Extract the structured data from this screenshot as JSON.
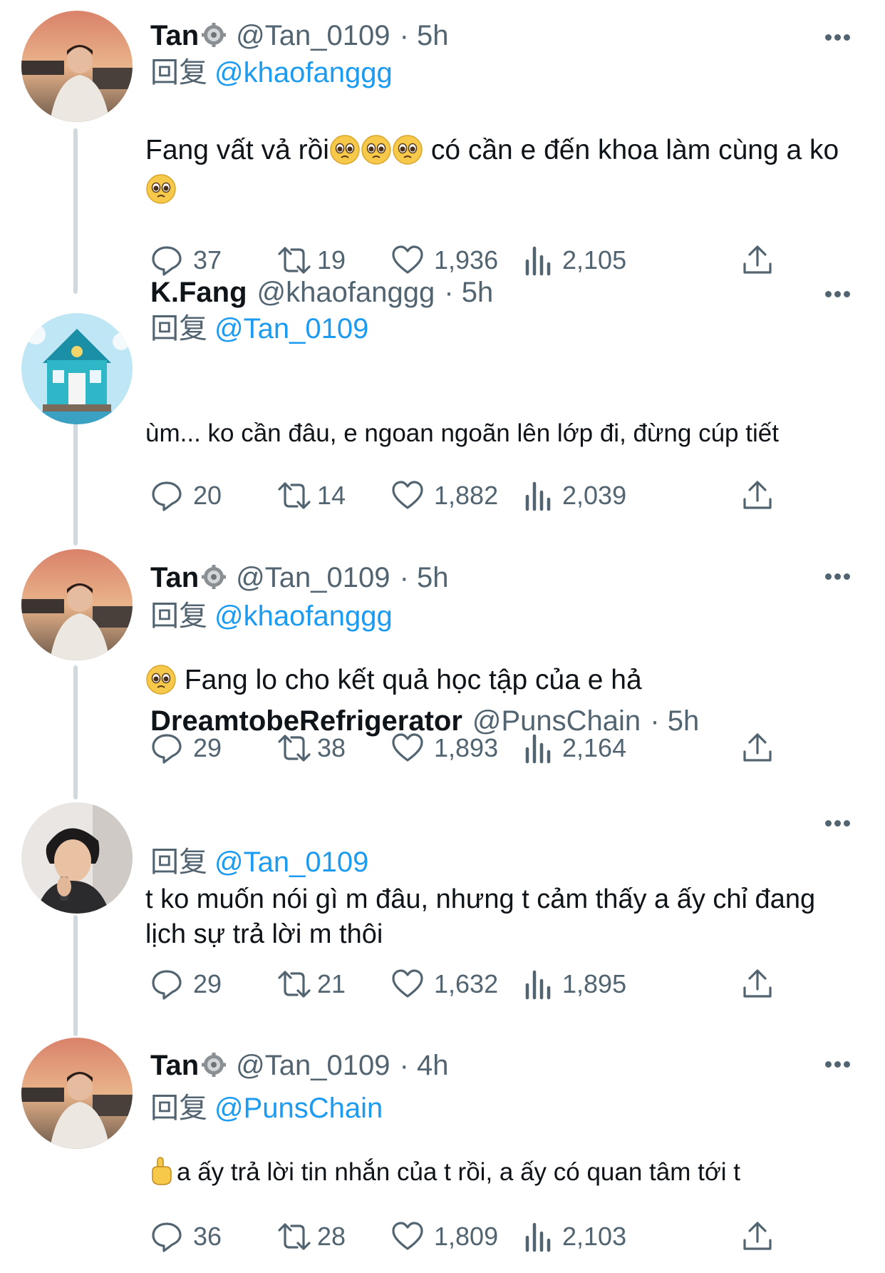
{
  "colors": {
    "link": "#1d9bf0",
    "secondary": "#536471",
    "thread_line": "#cfd9de"
  },
  "tweets": [
    {
      "name": "Tan",
      "badge": "gear-badge-icon",
      "handle": "@Tan_0109",
      "time": "· 5h",
      "reply_label": "回复",
      "reply_to": "@khaofanggg",
      "text_parts": [
        "Fang vất vả rồi",
        "có cần e đến khoa làm cùng a ko"
      ],
      "emoji": "pleading-face-icon",
      "replies": "37",
      "retweets": "19",
      "likes": "1,936",
      "views": "2,105"
    },
    {
      "name": "K.Fang",
      "handle": "@khaofanggg",
      "time": "· 5h",
      "reply_label": "回复",
      "reply_to": "@Tan_0109",
      "text": "ùm... ko cần đâu, e ngoan ngoãn lên lớp đi, đừng cúp tiết",
      "replies": "20",
      "retweets": "14",
      "likes": "1,882",
      "views": "2,039"
    },
    {
      "name": "Tan",
      "badge": "gear-badge-icon",
      "handle": "@Tan_0109",
      "time": "· 5h",
      "reply_label": "回复",
      "reply_to": "@khaofanggg",
      "text": "Fang lo cho kết quả học tập của e hả",
      "emoji": "pleading-face-icon",
      "replies": "29",
      "retweets": "38",
      "likes": "1,893",
      "views": "2,164"
    },
    {
      "name": "DreamtobeRefrigerator",
      "handle": "@PunsChain",
      "time": "· 5h",
      "reply_label": "回复",
      "reply_to": "@Tan_0109",
      "text": "t ko muốn nói gì m đâu, nhưng t cảm thấy a ấy chỉ đang lịch sự trả lời m thôi",
      "replies": "29",
      "retweets": "21",
      "likes": "1,632",
      "views": "1,895"
    },
    {
      "name": "Tan",
      "badge": "gear-badge-icon",
      "handle": "@Tan_0109",
      "time": "· 4h",
      "reply_label": "回复",
      "reply_to": "@PunsChain",
      "text": "a ấy trả lời tin nhắn của t rồi, a ấy có quan tâm tới t",
      "emoji": "pointing-up-hand-icon",
      "replies": "36",
      "retweets": "28",
      "likes": "1,809",
      "views": "2,103"
    }
  ]
}
